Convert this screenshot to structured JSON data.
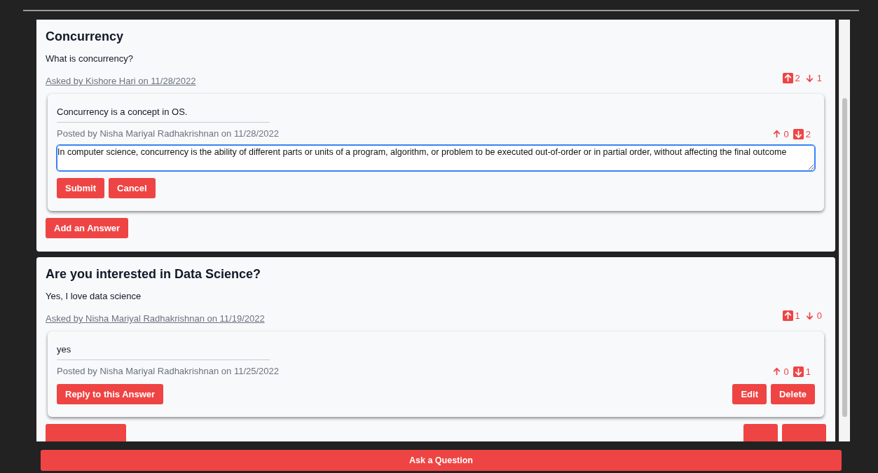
{
  "questions": [
    {
      "title": "Concurrency",
      "body": "What is concurrency?",
      "asked_by": "Asked by Kishore Hari on 11/28/2022",
      "votes": {
        "up": "2",
        "down": "1",
        "up_selected": true,
        "down_selected": false
      },
      "answers": [
        {
          "text": "Concurrency is a concept in OS.",
          "posted_by": "Posted by Nisha Mariyal Radhakrishnan on 11/28/2022",
          "votes": {
            "up": "0",
            "down": "2",
            "up_selected": false,
            "down_selected": true
          },
          "editor": {
            "value": "In computer science, concurrency is the ability of different parts or units of a program, algorithm, or problem to be executed out-of-order or in partial order, without affecting the final outcome",
            "buttons": [
              "Submit",
              "Cancel"
            ]
          }
        }
      ],
      "buttons": {
        "left": [
          "Add an Answer"
        ]
      }
    },
    {
      "title": "Are you interested in Data Science?",
      "body": "Yes, I love data science",
      "asked_by": "Asked by Nisha Mariyal Radhakrishnan on 11/19/2022",
      "votes": {
        "up": "1",
        "down": "0",
        "up_selected": true,
        "down_selected": false
      },
      "answers": [
        {
          "text": "yes",
          "posted_by": "Posted by Nisha Mariyal Radhakrishnan on 11/25/2022",
          "votes": {
            "up": "0",
            "down": "1",
            "up_selected": false,
            "down_selected": true
          },
          "buttons": {
            "left": [
              "Reply to this Answer"
            ],
            "right": [
              "Edit",
              "Delete"
            ]
          }
        }
      ],
      "cut_buttons": {
        "left": [
          {
            "kind": "answer"
          }
        ],
        "right": [
          {
            "kind": "edit"
          },
          {
            "kind": "delete"
          }
        ]
      }
    }
  ],
  "ask_button": "Ask a Question"
}
